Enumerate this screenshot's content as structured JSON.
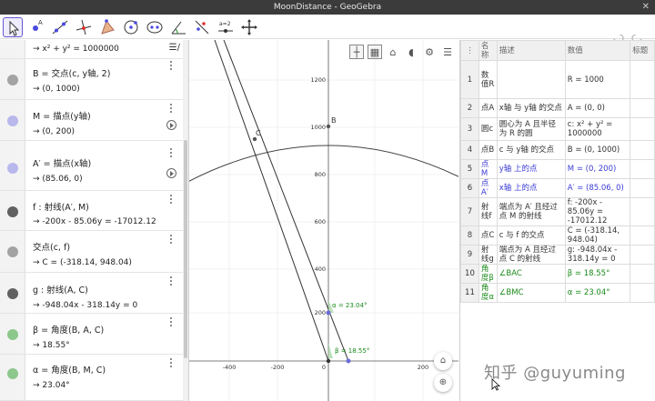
{
  "window": {
    "title": "MoonDistance - GeoGebra",
    "close": "✕"
  },
  "toolbar": {
    "tools": [
      "move-tool",
      "point-tool",
      "line-tool",
      "perpendicular-line-tool",
      "polygon-tool",
      "circle-tool",
      "ellipse-tool",
      "angle-tool",
      "reflect-tool",
      "slider-tool",
      "move-graphics-view-tool"
    ],
    "slider_label": "a=2"
  },
  "algebra": {
    "rows": [
      {
        "def": "",
        "val": "→  x² + y² = 1000000",
        "color": "#ffffff"
      },
      {
        "def": "B = 交点(c, y轴, 2)",
        "val": "→  (0, 1000)",
        "color": "#a3a3a3"
      },
      {
        "def": "M = 描点(y轴)",
        "val": "→  (0, 200)",
        "color": "#b8b8ec",
        "play": true
      },
      {
        "def": "A′ = 描点(x轴)",
        "val": "→  (85.06, 0)",
        "color": "#b8b8ec",
        "play": true
      },
      {
        "def": "f : 射线(A′, M)",
        "val": "→  -200x - 85.06y = -17012.12",
        "color": "#616161"
      },
      {
        "def": "交点(c, f)",
        "val": "→  C = (-318.14, 948.04)",
        "color": "#a3a3a3"
      },
      {
        "def": "g : 射线(A, C)",
        "val": "→  -948.04x - 318.14y = 0",
        "color": "#616161"
      },
      {
        "def": "β = 角度(B, A, C)",
        "val": "→  18.55°",
        "color": "#8cc78c"
      },
      {
        "def": "α = 角度(B, M, C)",
        "val": "→  23.04°",
        "color": "#8cc78c"
      }
    ]
  },
  "graphics": {
    "x_ticks": [
      "-400",
      "-200",
      "0",
      "200"
    ],
    "y_ticks": [
      "1200",
      "1000",
      "800",
      "600",
      "400",
      "200"
    ],
    "labels": {
      "B": "B",
      "C": "C",
      "alpha": "α = 23.04°",
      "beta": "β = 18.55°"
    },
    "tools": [
      "axes",
      "grid",
      "home",
      "style",
      "settings",
      "menu"
    ]
  },
  "spreadsheet": {
    "headers": [
      "",
      "名称",
      "描述",
      "数值",
      "标题"
    ],
    "rows": [
      {
        "n": "1",
        "name": "数值R",
        "desc": "",
        "value": "R = 1000",
        "cls": ""
      },
      {
        "n": "2",
        "name": "点A",
        "desc": "x轴 与 y轴 的交点",
        "value": "A = (0, 0)",
        "cls": ""
      },
      {
        "n": "3",
        "name": "圆c",
        "desc": "圆心为 A 且半径为 R 的圆",
        "value": "c: x² + y² = 1000000",
        "cls": ""
      },
      {
        "n": "4",
        "name": "点B",
        "desc": "c 与 y轴 的交点",
        "value": "B = (0, 1000)",
        "cls": ""
      },
      {
        "n": "5",
        "name": "点M",
        "desc": "y轴 上的点",
        "value": "M = (0, 200)",
        "cls": "blue"
      },
      {
        "n": "6",
        "name": "点A′",
        "desc": "x轴 上的点",
        "value": "A′ = (85.06, 0)",
        "cls": "blue"
      },
      {
        "n": "7",
        "name": "射线f",
        "desc": "端点为 A′ 且经过点 M 的射线",
        "value": "f: -200x - 85.06y = -17012.12",
        "cls": ""
      },
      {
        "n": "8",
        "name": "点C",
        "desc": "c 与 f 的交点",
        "value": "C = (-318.14, 948.04)",
        "cls": ""
      },
      {
        "n": "9",
        "name": "射线g",
        "desc": "端点为 A 且经过点 C 的射线",
        "value": "g: -948.04x - 318.14y = 0",
        "cls": ""
      },
      {
        "n": "10",
        "name": "角度β",
        "desc": "∠BAC",
        "value": "β = 18.55°",
        "cls": "green"
      },
      {
        "n": "11",
        "name": "角度α",
        "desc": "∠BMC",
        "value": "α = 23.04°",
        "cls": "green"
      }
    ]
  },
  "watermark": "知乎 @guyuming"
}
